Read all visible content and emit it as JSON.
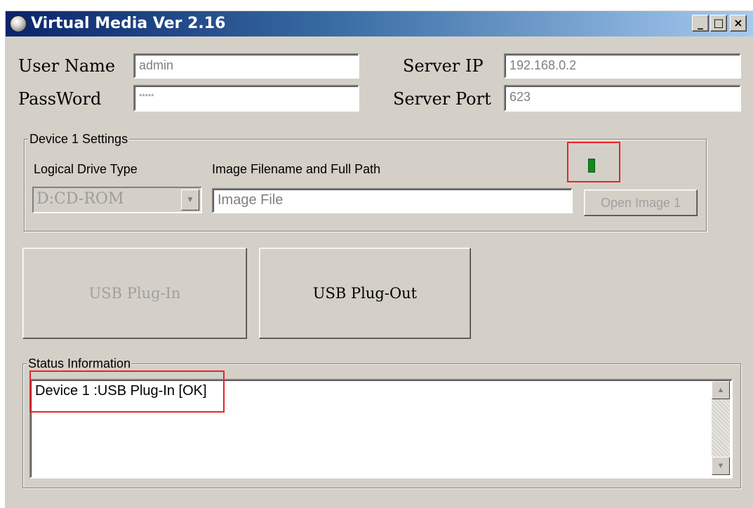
{
  "window": {
    "title": "Virtual Media Ver 2.16",
    "controls": {
      "minimize": "_",
      "maximize": "□",
      "close": "×"
    }
  },
  "login": {
    "user_name_label": "User Name",
    "user_name_value": "admin",
    "password_label": "PassWord",
    "password_value": "*****",
    "server_ip_label": "Server IP",
    "server_ip_value": "192.168.0.2",
    "server_port_label": "Server Port",
    "server_port_value": "623"
  },
  "device1": {
    "group_title": "Device 1 Settings",
    "drive_type_label": "Logical Drive Type",
    "image_path_label": "Image Filename and Full  Path",
    "drive_type_value": "D:CD-ROM",
    "image_file_placeholder": "Image File",
    "open_image_button": "Open Image 1",
    "status_led_color": "#0f8a1f"
  },
  "actions": {
    "plug_in_button": "USB Plug-In",
    "plug_out_button": "USB Plug-Out"
  },
  "status": {
    "group_title": "Status Information",
    "message": "Device 1 :USB Plug-In [OK]"
  },
  "icons": {
    "app_icon": "cd-disc-icon",
    "scroll_up": "▲",
    "scroll_down": "▼",
    "dropdown": "▼"
  },
  "colors": {
    "title_gradient_start": "#0a246a",
    "title_gradient_end": "#a6caf0",
    "highlight_box": "#e8242b",
    "window_face": "#d4d0c8"
  }
}
